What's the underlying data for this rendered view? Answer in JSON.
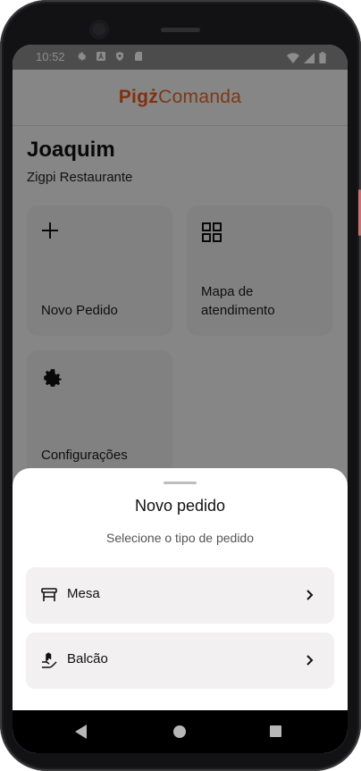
{
  "status": {
    "time": "10:52",
    "icons": [
      "settings-icon",
      "a-icon",
      "shield-icon",
      "sd-card-icon"
    ],
    "right_icons": [
      "wifi-icon",
      "signal-icon",
      "battery-icon"
    ]
  },
  "app": {
    "brand_bold": "Pigż",
    "brand_light": "Comanda",
    "user_name": "Joaquim",
    "restaurant": "Zigpi Restaurante",
    "cards": [
      {
        "label": "Novo Pedido",
        "icon": "plus-icon"
      },
      {
        "label": "Mapa de atendimento",
        "icon": "grid-icon"
      },
      {
        "label": "Configurações",
        "icon": "gear-icon"
      }
    ]
  },
  "sheet": {
    "title": "Novo pedido",
    "subtitle": "Selecione o tipo de pedido",
    "options": [
      {
        "label": "Mesa",
        "icon": "table-icon"
      },
      {
        "label": "Balcão",
        "icon": "counter-hand-icon"
      }
    ]
  },
  "colors": {
    "brand": "#e85a1a",
    "overlay": "rgba(0,0,0,0.45)",
    "sheet": "#ffffff",
    "option_bg": "#f2f0f0"
  }
}
